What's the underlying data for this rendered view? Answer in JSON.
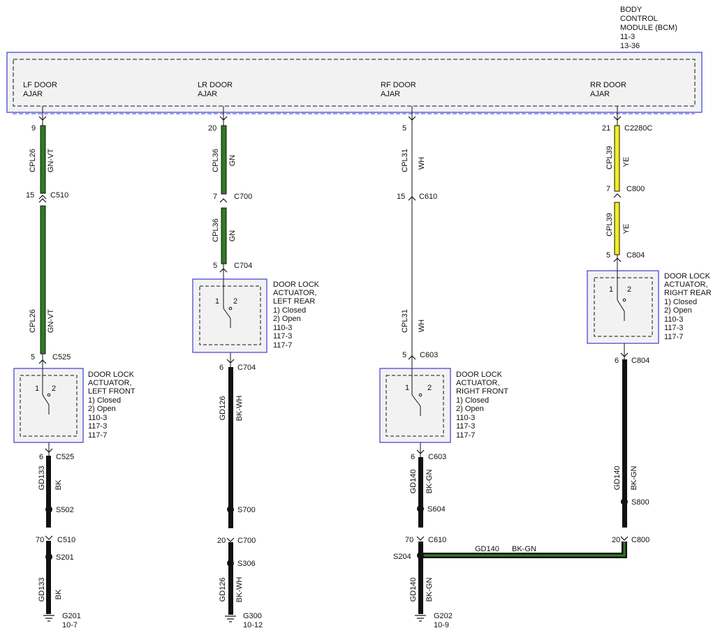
{
  "module": {
    "title_lines": [
      "BODY",
      "CONTROL",
      "MODULE (BCM)",
      "11-3",
      "13-36"
    ],
    "inputs": [
      {
        "line1": "LF DOOR",
        "line2": "AJAR"
      },
      {
        "line1": "LR DOOR",
        "line2": "AJAR"
      },
      {
        "line1": "RF DOOR",
        "line2": "AJAR"
      },
      {
        "line1": "RR DOOR",
        "line2": "AJAR"
      }
    ]
  },
  "pins": [
    {
      "pin": "9",
      "connector": ""
    },
    {
      "pin": "15",
      "connector": "C510"
    },
    {
      "pin": "5",
      "connector": "C525"
    },
    {
      "pin": "6",
      "connector": "C525"
    },
    {
      "pin": "70",
      "connector": "C510"
    },
    {
      "pin": "20",
      "connector": ""
    },
    {
      "pin": "7",
      "connector": "C700"
    },
    {
      "pin": "5",
      "connector": "C704"
    },
    {
      "pin": "6",
      "connector": "C704"
    },
    {
      "pin": "20",
      "connector": "C700"
    },
    {
      "pin": "5",
      "connector": ""
    },
    {
      "pin": "15",
      "connector": "C610"
    },
    {
      "pin": "5",
      "connector": "C603"
    },
    {
      "pin": "6",
      "connector": "C603"
    },
    {
      "pin": "70",
      "connector": "C610"
    },
    {
      "pin": "21",
      "connector": "C2280C"
    },
    {
      "pin": "7",
      "connector": "C800"
    },
    {
      "pin": "5",
      "connector": "C804"
    },
    {
      "pin": "6",
      "connector": "C804"
    },
    {
      "pin": "20",
      "connector": "C800"
    }
  ],
  "wires": [
    {
      "circuit": "CPL26",
      "color": "GN-VT"
    },
    {
      "circuit": "CPL26",
      "color": "GN-VT"
    },
    {
      "circuit": "GD133",
      "color": "BK"
    },
    {
      "circuit": "GD133",
      "color": "BK"
    },
    {
      "circuit": "CPL36",
      "color": "GN"
    },
    {
      "circuit": "CPL36",
      "color": "GN"
    },
    {
      "circuit": "GD126",
      "color": "BK-WH"
    },
    {
      "circuit": "GD126",
      "color": "BK-WH"
    },
    {
      "circuit": "CPL31",
      "color": "WH"
    },
    {
      "circuit": "CPL31",
      "color": "WH"
    },
    {
      "circuit": "GD140",
      "color": "BK-GN"
    },
    {
      "circuit": "GD140",
      "color": "BK-GN"
    },
    {
      "circuit": "CPL39",
      "color": "YE"
    },
    {
      "circuit": "CPL39",
      "color": "YE"
    },
    {
      "circuit": "GD140",
      "color": "BK-GN"
    }
  ],
  "jumper": {
    "circuit": "GD140",
    "color": "BK-GN"
  },
  "splices": [
    "S502",
    "S201",
    "S700",
    "S306",
    "S604",
    "S204",
    "S800"
  ],
  "actuators": [
    {
      "line1": "DOOR LOCK",
      "line2": "ACTUATOR,",
      "line3": "LEFT FRONT",
      "state1": "1) Closed",
      "state2": "2) Open",
      "ref1": "110-3",
      "ref2": "117-3",
      "ref3": "117-7",
      "pin1": "1",
      "pin2": "2"
    },
    {
      "line1": "DOOR LOCK",
      "line2": "ACTUATOR,",
      "line3": "LEFT REAR",
      "state1": "1) Closed",
      "state2": "2) Open",
      "ref1": "110-3",
      "ref2": "117-3",
      "ref3": "117-7",
      "pin1": "1",
      "pin2": "2"
    },
    {
      "line1": "DOOR LOCK",
      "line2": "ACTUATOR,",
      "line3": "RIGHT FRONT",
      "state1": "1) Closed",
      "state2": "2) Open",
      "ref1": "110-3",
      "ref2": "117-3",
      "ref3": "117-7",
      "pin1": "1",
      "pin2": "2"
    },
    {
      "line1": "DOOR LOCK",
      "line2": "ACTUATOR,",
      "line3": "RIGHT REAR",
      "state1": "1) Closed",
      "state2": "2) Open",
      "ref1": "110-3",
      "ref2": "117-3",
      "ref3": "117-7",
      "pin1": "1",
      "pin2": "2"
    }
  ],
  "grounds": [
    {
      "name": "G201",
      "ref": "10-7"
    },
    {
      "name": "G300",
      "ref": "10-12"
    },
    {
      "name": "G202",
      "ref": "10-9"
    }
  ],
  "colors": {
    "module_border": "#3b3bd6",
    "module_fill": "#f2f2f2",
    "wire_green": "#2e7d1e",
    "wire_yellow": "#f2ee1c",
    "wire_black": "#111111",
    "wire_outline": "#111111"
  }
}
